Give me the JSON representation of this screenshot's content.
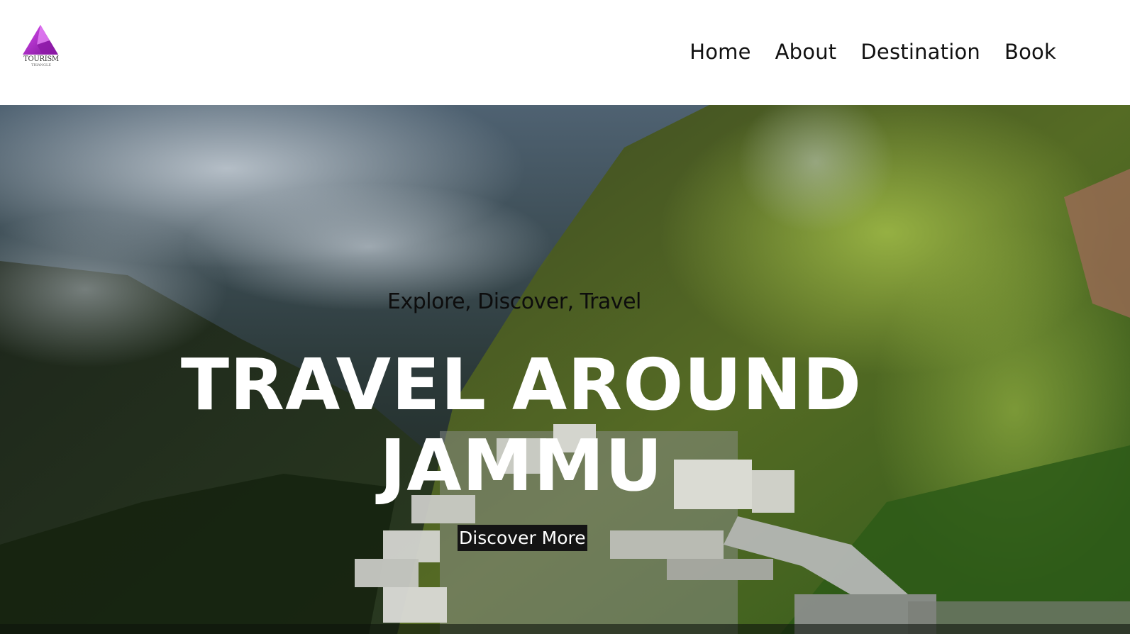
{
  "logo": {
    "icon": "triangle-mountain-icon",
    "text": "TOURISM",
    "subtext": "TRIANGLE",
    "color": "#b026c9"
  },
  "nav": {
    "items": [
      {
        "label": "Home"
      },
      {
        "label": "About"
      },
      {
        "label": "Destination"
      },
      {
        "label": "Book"
      }
    ]
  },
  "hero": {
    "tagline": "Explore, Discover, Travel",
    "headline_line1": "TRAVEL AROUND",
    "headline_line2": "JAMMU",
    "cta_label": "Discover More",
    "background": "aerial mountain photo with temple complex"
  }
}
